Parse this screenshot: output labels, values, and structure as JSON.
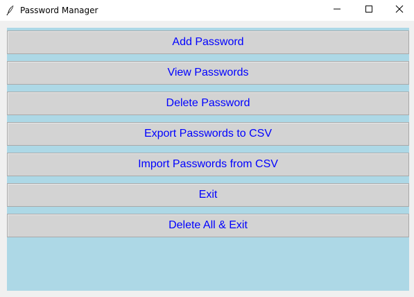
{
  "window": {
    "title": "Password Manager",
    "icon": "feather-icon",
    "controls": [
      "minimize-icon",
      "maximize-icon",
      "close-icon"
    ]
  },
  "colors": {
    "content_bg": "#add8e6",
    "button_bg": "#d3d3d3",
    "button_text": "#0000ff"
  },
  "buttons": [
    {
      "id": "add",
      "label": "Add Password"
    },
    {
      "id": "view",
      "label": "View Passwords"
    },
    {
      "id": "delete",
      "label": "Delete Password"
    },
    {
      "id": "export",
      "label": "Export Passwords to CSV"
    },
    {
      "id": "import",
      "label": "Import Passwords from CSV"
    },
    {
      "id": "exit",
      "label": "Exit"
    },
    {
      "id": "delete-all-exit",
      "label": "Delete All & Exit"
    }
  ]
}
